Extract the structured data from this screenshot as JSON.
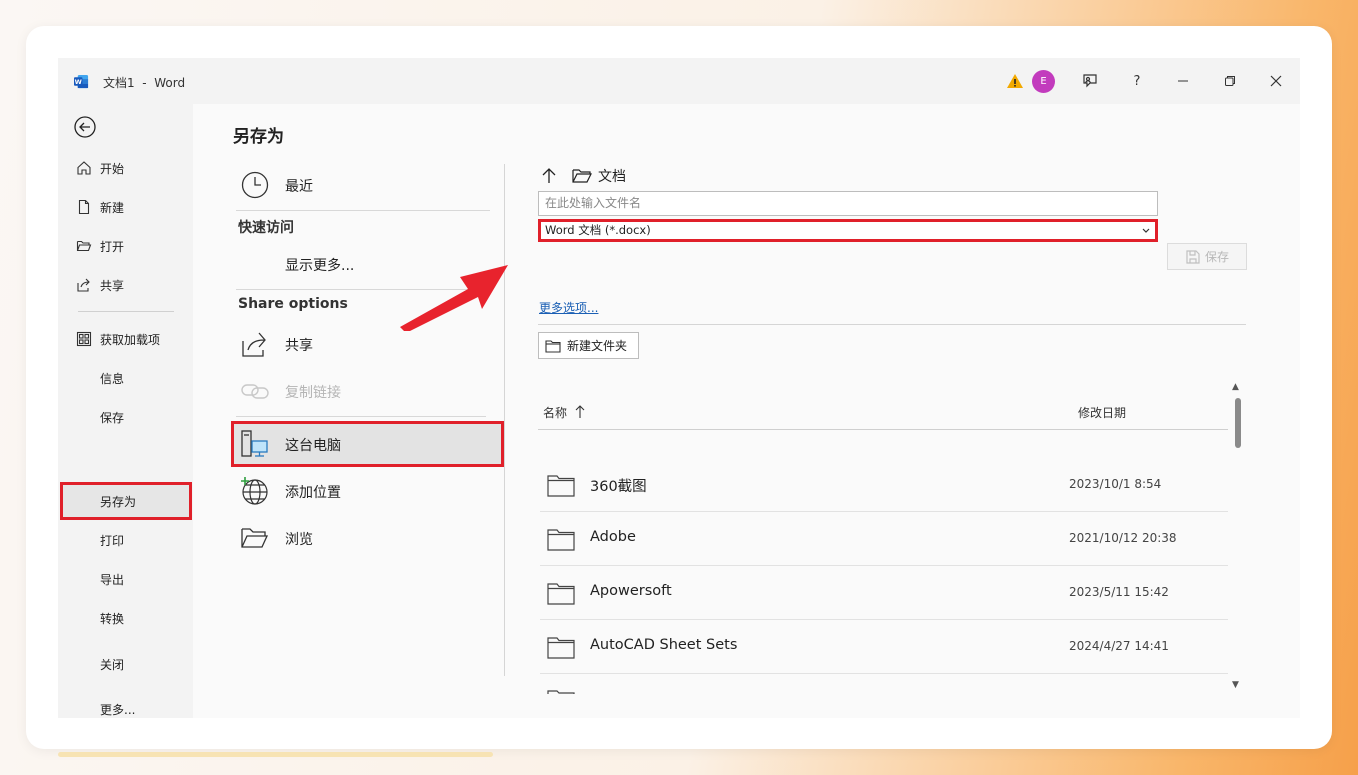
{
  "window": {
    "title": "文档1  -  Word",
    "avatar_initial": "E"
  },
  "titlebar_buttons": {
    "help": "?"
  },
  "leftnav": {
    "items": [
      {
        "label": "开始",
        "icon": "home-icon"
      },
      {
        "label": "新建",
        "icon": "new-document-icon"
      },
      {
        "label": "打开",
        "icon": "open-folder-icon"
      },
      {
        "label": "共享",
        "icon": "share-icon"
      },
      {
        "label": "获取加载项",
        "icon": "addins-grid-icon"
      },
      {
        "label": "信息"
      },
      {
        "label": "保存"
      },
      {
        "label": "另存为",
        "active": true
      },
      {
        "label": "打印"
      },
      {
        "label": "导出"
      },
      {
        "label": "转换"
      },
      {
        "label": "关闭"
      },
      {
        "label": "更多..."
      }
    ]
  },
  "page": {
    "title": "另存为"
  },
  "locations": {
    "recent": "最近",
    "quick_access_heading": "快速访问",
    "show_more": "显示更多...",
    "share_heading": "Share options",
    "share": "共享",
    "copy_link": "复制链接",
    "this_pc": "这台电脑",
    "add_place": "添加位置",
    "browse": "浏览"
  },
  "save_panel": {
    "path_folder": "文档",
    "filename_placeholder": "在此处输入文件名",
    "file_type": "Word 文档 (*.docx)",
    "save_label": "保存",
    "more_options": "更多选项...",
    "new_folder": "新建文件夹",
    "col_name": "名称",
    "col_date": "修改日期",
    "files": [
      {
        "name": "360截图",
        "date": "2023/10/1 8:54"
      },
      {
        "name": "Adobe",
        "date": "2021/10/12 20:38"
      },
      {
        "name": "Apowersoft",
        "date": "2023/5/11 15:42"
      },
      {
        "name": "AutoCAD Sheet Sets",
        "date": "2024/4/27 14:41"
      }
    ]
  },
  "colors": {
    "highlight_red": "#e0202a",
    "link_blue": "#1a5fb4",
    "avatar": "#c23bbd"
  }
}
